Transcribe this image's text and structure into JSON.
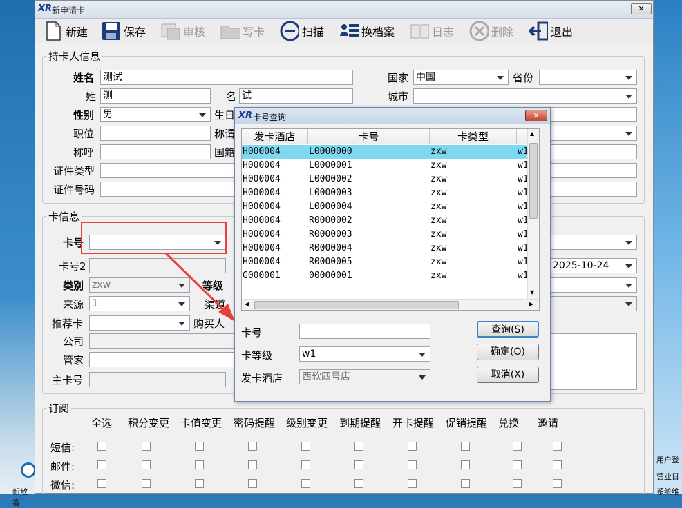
{
  "window": {
    "title": "新申请卡",
    "close": "✕"
  },
  "toolbar": [
    {
      "label": "新建",
      "icon": "new-file-icon",
      "enabled": true
    },
    {
      "label": "保存",
      "icon": "save-icon",
      "enabled": true
    },
    {
      "label": "审核",
      "icon": "audit-icon",
      "enabled": false
    },
    {
      "label": "写卡",
      "icon": "write-card-icon",
      "enabled": false
    },
    {
      "label": "扫描",
      "icon": "scan-icon",
      "enabled": true
    },
    {
      "label": "换档案",
      "icon": "switch-profile-icon",
      "enabled": true
    },
    {
      "label": "日志",
      "icon": "log-icon",
      "enabled": false
    },
    {
      "label": "删除",
      "icon": "delete-icon",
      "enabled": false
    },
    {
      "label": "退出",
      "icon": "exit-icon",
      "enabled": true
    }
  ],
  "holder": {
    "group": "持卡人信息",
    "name_label": "姓名",
    "name_value": "测试",
    "surname_label": "姓",
    "surname_value": "测",
    "given_label": "名",
    "given_value": "试",
    "gender_label": "性别",
    "gender_value": "男",
    "birth_label": "生日",
    "position_label": "职位",
    "title2_label": "称谓",
    "salutation_label": "称呼",
    "nationality_label": "国籍",
    "id_type_label": "证件类型",
    "id_no_label": "证件号码",
    "country_label": "国家",
    "country_value": "中国",
    "province_label": "省份",
    "city_label": "城市"
  },
  "card": {
    "group": "卡信息",
    "cardno_label": "卡号",
    "cardno2_label": "卡号2",
    "type_label": "类别",
    "type_value": "zxw",
    "level_label": "等级",
    "source_label": "来源",
    "source_value": "1",
    "channel_label": "渠道",
    "referrer_label": "推荐卡",
    "buyer_label": "购买人",
    "company_label": "公司",
    "steward_label": "管家",
    "main_card_label": "主卡号",
    "expiry_value": "2025-10-24"
  },
  "subscribe": {
    "group": "订阅",
    "columns": [
      "全选",
      "积分变更",
      "卡值变更",
      "密码提醒",
      "级别变更",
      "到期提醒",
      "开卡提醒",
      "促销提醒",
      "兑换",
      "邀请"
    ],
    "rows": [
      "短信:",
      "邮件:",
      "微信:"
    ]
  },
  "dialog": {
    "title": "卡号查询",
    "close": "✕",
    "headers": [
      "发卡酒店",
      "卡号",
      "卡类型"
    ],
    "rows": [
      {
        "hotel": "H000004",
        "card": "L0000000",
        "type": "zxw",
        "extra": "w1"
      },
      {
        "hotel": "H000004",
        "card": "L0000001",
        "type": "zxw",
        "extra": "w1"
      },
      {
        "hotel": "H000004",
        "card": "L0000002",
        "type": "zxw",
        "extra": "w1"
      },
      {
        "hotel": "H000004",
        "card": "L0000003",
        "type": "zxw",
        "extra": "w1"
      },
      {
        "hotel": "H000004",
        "card": "L0000004",
        "type": "zxw",
        "extra": "w1"
      },
      {
        "hotel": "H000004",
        "card": "R0000002",
        "type": "zxw",
        "extra": "w1"
      },
      {
        "hotel": "H000004",
        "card": "R0000003",
        "type": "zxw",
        "extra": "w1"
      },
      {
        "hotel": "H000004",
        "card": "R0000004",
        "type": "zxw",
        "extra": "w1"
      },
      {
        "hotel": "H000004",
        "card": "R0000005",
        "type": "zxw",
        "extra": "w1"
      },
      {
        "hotel": "G000001",
        "card": "00000001",
        "type": "zxw",
        "extra": "w1"
      }
    ],
    "cardno_label": "卡号",
    "level_label": "卡等级",
    "level_value": "w1",
    "hotel_label": "发卡酒店",
    "hotel_value": "西软四号店",
    "query_btn": "查询(S)",
    "ok_btn": "确定(O)",
    "cancel_btn": "取消(X)"
  },
  "desktop": {
    "right_labels": [
      "用户登",
      "营业日",
      "系统维"
    ],
    "left_label": "新散客"
  },
  "colors": {
    "selected_row": "#7fd8f2",
    "highlight": "#e8413a"
  }
}
